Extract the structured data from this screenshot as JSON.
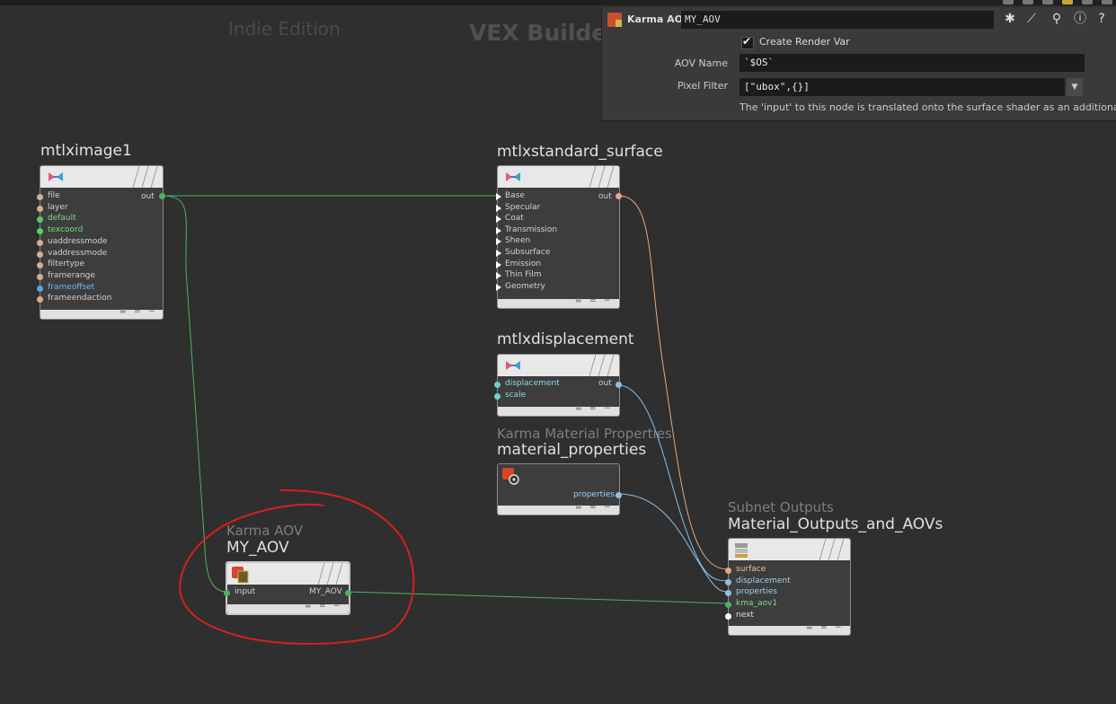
{
  "watermark": {
    "edition": "Indie Edition",
    "context": "VEX Builder"
  },
  "param_pane": {
    "node_type": "Karma AOV",
    "node_name": "MY_AOV",
    "create_render_var_label": "Create Render Var",
    "create_render_var_checked": true,
    "aov_name_label": "AOV Name",
    "aov_name_value": "`$OS`",
    "pixel_filter_label": "Pixel Filter",
    "pixel_filter_value": "[\"ubox\",{}]",
    "help_text": "The 'input' to this node is translated onto the surface shader as an additional input."
  },
  "nodes": {
    "mtlximage": {
      "name": "mtlximage1",
      "inputs": [
        "file",
        "layer",
        "default",
        "texcoord",
        "uaddressmode",
        "vaddressmode",
        "filtertype",
        "framerange",
        "frameoffset",
        "frameendaction"
      ],
      "output": "out"
    },
    "standard_surface": {
      "name": "mtlxstandard_surface",
      "inputs": [
        "Base",
        "Specular",
        "Coat",
        "Transmission",
        "Sheen",
        "Subsurface",
        "Emission",
        "Thin Film",
        "Geometry"
      ],
      "output": "out"
    },
    "displacement": {
      "name": "mtlxdisplacement",
      "inputs": [
        "displacement",
        "scale"
      ],
      "output": "out"
    },
    "material_properties": {
      "type": "Karma Material Properties",
      "name": "material_properties",
      "output": "properties"
    },
    "karma_aov": {
      "type": "Karma AOV",
      "name": "MY_AOV",
      "input": "input",
      "output": "MY_AOV"
    },
    "subnet_outputs": {
      "type": "Subnet Outputs",
      "name": "Material_Outputs_and_AOVs",
      "inputs": [
        "surface",
        "displacement",
        "properties",
        "kma_aov1",
        "next"
      ]
    }
  },
  "footer_glyphs": {
    "a": "≡",
    "b": "=",
    "c": "−"
  },
  "colors": {
    "background": "#2f2f2f",
    "wire_green": "#4fb062",
    "wire_orange": "#e6a882",
    "wire_blue": "#8cc0e8",
    "annotation_red": "#d42020"
  }
}
